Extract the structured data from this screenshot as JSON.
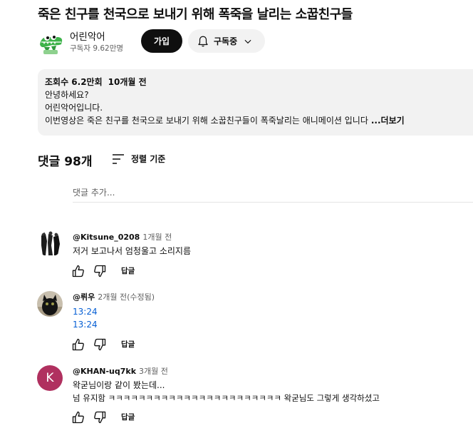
{
  "video": {
    "title": "죽은 친구를 천국으로 보내기 위해 폭죽을 날리는 소꿉친구들"
  },
  "channel": {
    "name": "어린악어",
    "subscribers": "구독자 9.62만명",
    "join_label": "가입",
    "subscribed_label": "구독중"
  },
  "description": {
    "views": "조회수 6.2만회",
    "date": "10개월 전",
    "lines": [
      "안녕하세요?",
      "어린악어입니다.",
      "이번영상은 죽은 친구를 천국으로 보내기 위해 소꿉친구들이 폭죽날리는 애니메이션 입니다"
    ],
    "more_label": "...더보기"
  },
  "comments": {
    "count_label": "댓글 98개",
    "sort_label": "정렬 기준",
    "add_placeholder": "댓글 추가...",
    "items": [
      {
        "author": "@Kitsune_0208",
        "time": "1개월 전",
        "text": [
          "저거 보고나서 엄청울고 소리지름"
        ],
        "reply_label": "답글"
      },
      {
        "author": "@뤼우",
        "time": "2개월 전(수정됨)",
        "text": [
          "13:24",
          "13:24"
        ],
        "reply_label": "답글"
      },
      {
        "author": "@KHAN-uq7kk",
        "time": "3개월 전",
        "avatar_letter": "K",
        "text": [
          "왁굳님이랑 같이 봤는데...",
          "넘 유지함 ㅋㅋㅋㅋㅋㅋㅋㅋㅋㅋㅋㅋㅋㅋㅋㅋㅋㅋㅋㅋㅋㅋㅋ 왁굳님도 그렇게 생각하셨고"
        ],
        "reply_label": "답글"
      }
    ]
  },
  "colors": {
    "link": "#065fd4",
    "avatar_k": "#b0305f",
    "logo_green": "#3db34a"
  },
  "icons": [
    "crocodile-logo",
    "bell-icon",
    "chevron-down-icon",
    "sort-icon",
    "thumbs-up-icon",
    "thumbs-down-icon"
  ]
}
